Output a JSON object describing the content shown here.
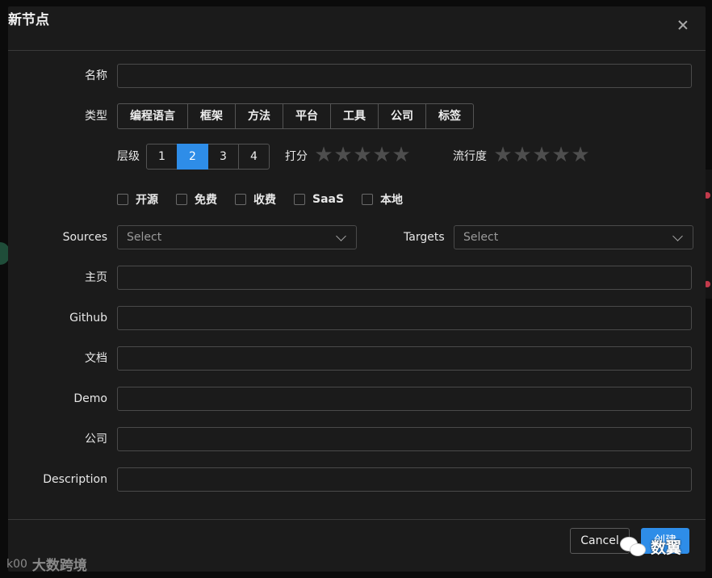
{
  "dialog": {
    "title": "新节点"
  },
  "labels": {
    "name": "名称",
    "type": "类型",
    "level": "层级",
    "rating": "打分",
    "popularity": "流行度",
    "sources": "Sources",
    "targets": "Targets",
    "homepage": "主页",
    "github": "Github",
    "docs": "文档",
    "demo": "Demo",
    "company": "公司",
    "description": "Description"
  },
  "type_options": [
    "编程语言",
    "框架",
    "方法",
    "平台",
    "工具",
    "公司",
    "标签"
  ],
  "level_options": [
    "1",
    "2",
    "3",
    "4"
  ],
  "level_selected": "2",
  "rating": {
    "value": 0,
    "max": 5
  },
  "popularity": {
    "value": 0,
    "max": 5
  },
  "checkboxes": [
    "开源",
    "免费",
    "收费",
    "SaaS",
    "本地"
  ],
  "sources_select": {
    "placeholder": "Select"
  },
  "targets_select": {
    "placeholder": "Select"
  },
  "fields": {
    "name_value": "",
    "homepage_value": "",
    "github_value": "",
    "docs_value": "",
    "demo_value": "",
    "company_value": "",
    "description_value": ""
  },
  "buttons": {
    "cancel": "Cancel",
    "create": "创建"
  },
  "watermarks": {
    "left_logo": "k00",
    "left": "大数跨境",
    "right": "数翼"
  },
  "colors": {
    "accent": "#2e8de8",
    "background": "#1b1b1b",
    "star_empty": "#4e4e4e"
  },
  "icons": {
    "close": "close-icon",
    "star": "star-icon",
    "chevron": "chevron-down-icon",
    "wechat": "wechat-icon"
  }
}
